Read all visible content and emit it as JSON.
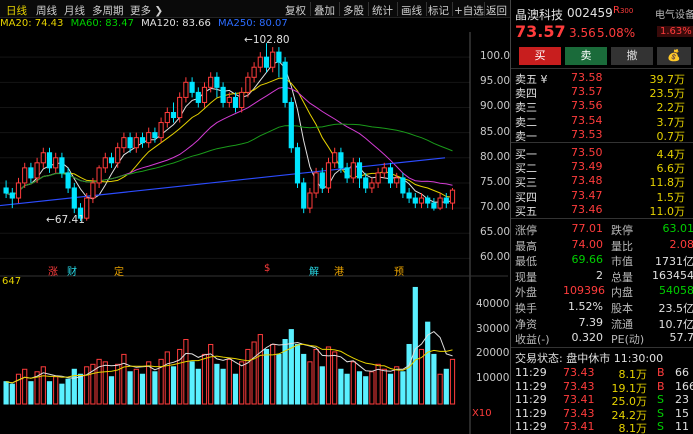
{
  "toolbar": {
    "left": [
      "日线",
      "周线",
      "月线",
      "多周期",
      "更多"
    ],
    "right": [
      "复权",
      "叠加",
      "多股",
      "统计",
      "画线",
      "标记",
      "+自选",
      "返回"
    ]
  },
  "ma_legend": {
    "ma20": "MA20: 74.43",
    "ma60": "MA60: 83.47",
    "ma120": "MA120: 83.66",
    "ma250": "MA250: 80.07"
  },
  "annotations": {
    "high": "102.80",
    "low": "67.41"
  },
  "price_axis": [
    "100.00",
    "95.00",
    "90.00",
    "85.00",
    "80.00",
    "75.00",
    "70.00",
    "65.00",
    "60.00"
  ],
  "volume_axis": [
    "40000",
    "30000",
    "20000",
    "10000"
  ],
  "volume_unit": "X10",
  "volume_label": "647",
  "events": [
    "涨",
    "财",
    "定",
    "$",
    "解",
    "港",
    "预"
  ],
  "stock": {
    "name": "晶澳科技",
    "code": "002459",
    "badge": "R",
    "badge_num": "300",
    "sector": "电气设备",
    "sector_pct": "1.63%",
    "price": "73.57",
    "change": "3.56",
    "pct": "5.08%"
  },
  "buttons": {
    "buy": "买",
    "sell": "卖",
    "cancel": "撤",
    "other": "💰"
  },
  "sell_orders": [
    {
      "label": "卖五 ¥",
      "price": "73.58",
      "vol": "39.7万"
    },
    {
      "label": "卖四",
      "price": "73.57",
      "vol": "23.5万"
    },
    {
      "label": "卖三",
      "price": "73.56",
      "vol": "2.2万"
    },
    {
      "label": "卖二",
      "price": "73.54",
      "vol": "3.7万"
    },
    {
      "label": "卖一",
      "price": "73.53",
      "vol": "0.7万"
    }
  ],
  "buy_orders": [
    {
      "label": "买一",
      "price": "73.50",
      "vol": "4.4万"
    },
    {
      "label": "买二",
      "price": "73.49",
      "vol": "6.6万"
    },
    {
      "label": "买三",
      "price": "73.48",
      "vol": "11.8万"
    },
    {
      "label": "买四",
      "price": "73.47",
      "vol": "1.5万"
    },
    {
      "label": "买五",
      "price": "73.46",
      "vol": "11.0万"
    }
  ],
  "stats": [
    {
      "k1": "涨停",
      "v1": "77.01",
      "k2": "跌停",
      "v2": "63.01"
    },
    {
      "k1": "最高",
      "v1": "74.00",
      "k2": "量比",
      "v2": "2.08"
    },
    {
      "k1": "最低",
      "v1": "69.66",
      "k2": "市值",
      "v2": "1731亿"
    },
    {
      "k1": "现量",
      "v1": "2",
      "k2": "总量",
      "v2": "163454"
    },
    {
      "k1": "外盘",
      "v1": "109396",
      "k2": "内盘",
      "v2": "54058"
    },
    {
      "k1": "换手",
      "v1": "1.52%",
      "k2": "股本",
      "v2": "23.5亿"
    },
    {
      "k1": "净资",
      "v1": "7.39",
      "k2": "流通",
      "v2": "10.7亿"
    },
    {
      "k1": "收益(-)",
      "v1": "0.320",
      "k2": "PE(动)",
      "v2": "57.7"
    }
  ],
  "status": "交易状态: 盘中休市 11:30:00",
  "ticks": [
    {
      "time": "11:29",
      "price": "73.43",
      "vol": "8.1万",
      "side": "B",
      "extra": "66"
    },
    {
      "time": "11:29",
      "price": "73.43",
      "vol": "19.1万",
      "side": "B",
      "extra": "166"
    },
    {
      "time": "11:29",
      "price": "73.41",
      "vol": "25.0万",
      "side": "S",
      "extra": "23"
    },
    {
      "time": "11:29",
      "price": "73.43",
      "vol": "24.2万",
      "side": "S",
      "extra": "15"
    },
    {
      "time": "11:29",
      "price": "73.41",
      "vol": "8.1万",
      "side": "S",
      "extra": "11"
    }
  ],
  "candles": [
    [
      74,
      73,
      75.5,
      72
    ],
    [
      73,
      72,
      74,
      70
    ],
    [
      72,
      75,
      76,
      71
    ],
    [
      75,
      78,
      79,
      74
    ],
    [
      78,
      76,
      79,
      75
    ],
    [
      76,
      79,
      80,
      75
    ],
    [
      79,
      81,
      82,
      78
    ],
    [
      81,
      78,
      82,
      77
    ],
    [
      78,
      80,
      81,
      77
    ],
    [
      80,
      77,
      81,
      76
    ],
    [
      77,
      74,
      78,
      73
    ],
    [
      74,
      70,
      75,
      69
    ],
    [
      70,
      68,
      71,
      67.4
    ],
    [
      68,
      72,
      73,
      67.5
    ],
    [
      72,
      75,
      76,
      71
    ],
    [
      75,
      78,
      78.5,
      74
    ],
    [
      78,
      80,
      81,
      77
    ],
    [
      80,
      79,
      81,
      78
    ],
    [
      79,
      82,
      83,
      78
    ],
    [
      82,
      84,
      85,
      81
    ],
    [
      84,
      82,
      85,
      81
    ],
    [
      82,
      84,
      85,
      81
    ],
    [
      84,
      83,
      85,
      82
    ],
    [
      83,
      85,
      86,
      82
    ],
    [
      85,
      84,
      86,
      83
    ],
    [
      84,
      87,
      88,
      83
    ],
    [
      87,
      89,
      90,
      86
    ],
    [
      89,
      88,
      91,
      87
    ],
    [
      88,
      92,
      93,
      87
    ],
    [
      92,
      95,
      96,
      91
    ],
    [
      95,
      93,
      96,
      92
    ],
    [
      93,
      91,
      94,
      90
    ],
    [
      91,
      94,
      95,
      90
    ],
    [
      94,
      96,
      97,
      93
    ],
    [
      96,
      94,
      97,
      92
    ],
    [
      94,
      91,
      95,
      90
    ],
    [
      91,
      92,
      93,
      90
    ],
    [
      92,
      90,
      93,
      89
    ],
    [
      90,
      93,
      94,
      89
    ],
    [
      93,
      96,
      97,
      92
    ],
    [
      96,
      98,
      99,
      95
    ],
    [
      98,
      100,
      101,
      97
    ],
    [
      100,
      98,
      102.8,
      97
    ],
    [
      98,
      101,
      102,
      97
    ],
    [
      101,
      99,
      102,
      96
    ],
    [
      99,
      91,
      100,
      90
    ],
    [
      91,
      82,
      92,
      81
    ],
    [
      82,
      75,
      83,
      74
    ],
    [
      75,
      70,
      76,
      69
    ],
    [
      70,
      73,
      74,
      69
    ],
    [
      73,
      77,
      78,
      72
    ],
    [
      77,
      74,
      78,
      73
    ],
    [
      74,
      79,
      80,
      73
    ],
    [
      79,
      81,
      82,
      78
    ],
    [
      81,
      78,
      82,
      77
    ],
    [
      78,
      76,
      79,
      75
    ],
    [
      76,
      79,
      80,
      75
    ],
    [
      79,
      76,
      80,
      74
    ],
    [
      76,
      74,
      77,
      73
    ],
    [
      74,
      75,
      76,
      73
    ],
    [
      75,
      77,
      78,
      74
    ],
    [
      77,
      78,
      79,
      76
    ],
    [
      78,
      75,
      79,
      74
    ],
    [
      75,
      76,
      77,
      74
    ],
    [
      76,
      73,
      77,
      72
    ],
    [
      73,
      72,
      74,
      71
    ],
    [
      72,
      71,
      73,
      70
    ],
    [
      71,
      72,
      73,
      70
    ],
    [
      72,
      71,
      72.5,
      70
    ],
    [
      71,
      70,
      72,
      69.5
    ],
    [
      70,
      72,
      73,
      69.6
    ],
    [
      72,
      71,
      73,
      70
    ],
    [
      71,
      73.57,
      74,
      69.66
    ]
  ],
  "volumes": [
    9,
    8,
    12,
    14,
    9,
    13,
    15,
    9,
    11,
    8,
    10,
    14,
    12,
    15,
    16,
    18,
    17,
    11,
    16,
    20,
    13,
    14,
    12,
    17,
    13,
    18,
    21,
    15,
    22,
    26,
    17,
    14,
    20,
    24,
    16,
    14,
    18,
    12,
    17,
    22,
    25,
    28,
    22,
    24,
    20,
    26,
    30,
    24,
    20,
    17,
    22,
    15,
    23,
    21,
    14,
    12,
    17,
    13,
    11,
    13,
    16,
    14,
    12,
    15,
    13,
    24,
    47,
    22,
    33,
    20,
    12,
    14,
    18
  ]
}
